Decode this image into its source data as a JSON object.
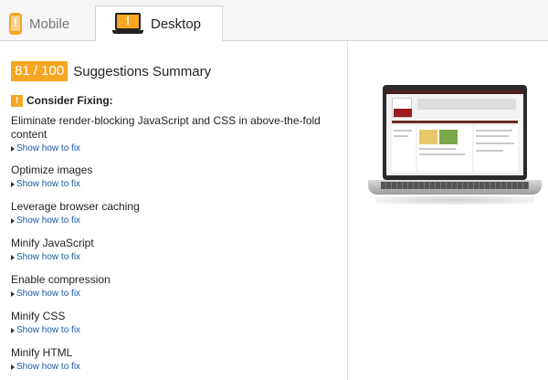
{
  "tabs": {
    "mobile_label": "Mobile",
    "desktop_label": "Desktop",
    "icon_mark": "!"
  },
  "summary": {
    "score": "81 / 100",
    "title": "Suggestions Summary"
  },
  "consider": {
    "icon_mark": "!",
    "label": "Consider Fixing:"
  },
  "rules": [
    {
      "title": "Eliminate render-blocking JavaScript and CSS in above-the-fold content",
      "link": "Show how to fix"
    },
    {
      "title": "Optimize images",
      "link": "Show how to fix"
    },
    {
      "title": "Leverage browser caching",
      "link": "Show how to fix"
    },
    {
      "title": "Minify JavaScript",
      "link": "Show how to fix"
    },
    {
      "title": "Enable compression",
      "link": "Show how to fix"
    },
    {
      "title": "Minify CSS",
      "link": "Show how to fix"
    },
    {
      "title": "Minify HTML",
      "link": "Show how to fix"
    }
  ],
  "colors": {
    "accent": "#f5a623",
    "link": "#1a5aa6"
  }
}
